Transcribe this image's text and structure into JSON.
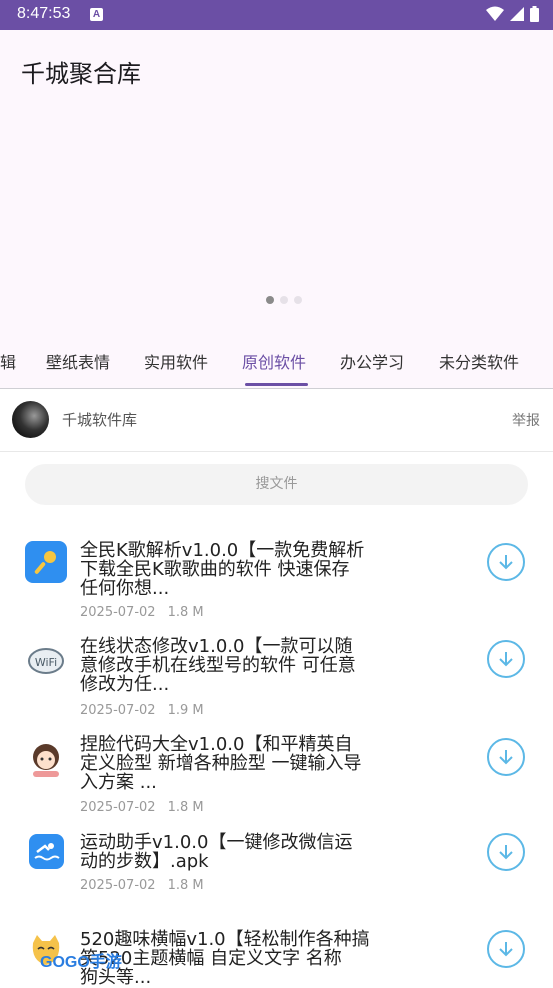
{
  "status": {
    "time": "8:47:53"
  },
  "header": {
    "title": "千城聚合库"
  },
  "tabs": [
    {
      "label": "辑"
    },
    {
      "label": "壁纸表情"
    },
    {
      "label": "实用软件"
    },
    {
      "label": "原创软件"
    },
    {
      "label": "办公学习"
    },
    {
      "label": "未分类软件"
    }
  ],
  "author": {
    "name": "千城软件库",
    "report": "举报"
  },
  "search": {
    "placeholder": "搜文件"
  },
  "files": [
    {
      "lines": [
        "全民K歌解析v1.0.0【一款免费解析",
        "下载全民K歌歌曲的软件 快速保存",
        "任何你想..."
      ],
      "date": "2025-07-02",
      "size": "1.8 M"
    },
    {
      "lines": [
        "在线状态修改v1.0.0【一款可以随",
        "意修改手机在线型号的软件 可任意",
        "修改为任..."
      ],
      "date": "2025-07-02",
      "size": "1.9 M"
    },
    {
      "lines": [
        "捏脸代码大全v1.0.0【和平精英自",
        "定义脸型 新增各种脸型 一键输入导",
        "入方案 ..."
      ],
      "date": "2025-07-02",
      "size": "1.8 M"
    },
    {
      "lines": [
        "运动助手v1.0.0【一键修改微信运",
        "动的步数】.apk"
      ],
      "date": "2025-07-02",
      "size": "1.8 M"
    },
    {
      "lines": [
        "520趣味横幅v1.0【轻松制作各种搞",
        "笑520主题横幅 自定义文字 名称",
        "狗头等..."
      ],
      "date": "",
      "size": ""
    }
  ],
  "watermark": "GOGO手游"
}
